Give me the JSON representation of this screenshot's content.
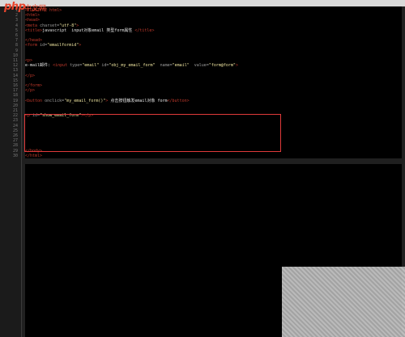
{
  "logo": {
    "brand": "php",
    "chinese": "中文网"
  },
  "editor": {
    "lines": [
      {
        "n": "1",
        "html": "<span class='tag'>&lt;!DOCTYPE html&gt;</span>"
      },
      {
        "n": "2",
        "html": "<span class='tag'>&lt;html&gt;</span>"
      },
      {
        "n": "3",
        "html": "<span class='tag'>&lt;head&gt;</span>"
      },
      {
        "n": "4",
        "html": "<span class='tag'>&lt;meta</span> <span class='attr'>charset=</span><span class='str'>\"utf-8\"</span><span class='tag'>&gt;</span>"
      },
      {
        "n": "5",
        "html": "<span class='tag'>&lt;title&gt;</span><span class='txt'>javascript  input对象email 类型form属性</span> <span class='tag'>&lt;/title&gt;</span>"
      },
      {
        "n": "6",
        "html": ""
      },
      {
        "n": "7",
        "html": "<span class='tag'>&lt;/head&gt;</span>"
      },
      {
        "n": "8",
        "html": "<span class='tag'>&lt;form</span> <span class='attr'>id=</span><span class='str'>\"emailformid\"</span><span class='tag'>&gt;</span>"
      },
      {
        "n": "9",
        "html": ""
      },
      {
        "n": "10",
        "html": ""
      },
      {
        "n": "11",
        "html": "<span class='tag'>&lt;p&gt;</span>"
      },
      {
        "n": "12",
        "html": "<span class='txt'>e-mail邮件: </span><span class='tag'>&lt;input</span> <span class='attr'>type=</span><span class='str'>\"email\"</span> <span class='attr'>id=</span><span class='str'>\"obj_my_email_form\"</span>  <span class='attr'>name=</span><span class='str'>\"email\"</span>  <span class='attr'>value=</span><span class='str'>\"form@form\"</span><span class='tag'>&gt;</span>"
      },
      {
        "n": "13",
        "html": ""
      },
      {
        "n": "14",
        "html": "<span class='tag'>&lt;/p&gt;</span>"
      },
      {
        "n": "15",
        "html": ""
      },
      {
        "n": "16",
        "html": "<span class='tag'>&lt;/form&gt;</span>"
      },
      {
        "n": "17",
        "html": "<span class='tag'>&lt;/p&gt;</span>"
      },
      {
        "n": "18",
        "html": ""
      },
      {
        "n": "19",
        "html": "<span class='tag'>&lt;button</span> <span class='attr'>onclick=</span><span class='str'>\"my_email_form()\"</span><span class='tag'>&gt;</span><span class='txt'> 点击按钮触发email对象 form</span><span class='tag'>&lt;/button&gt;</span>"
      },
      {
        "n": "20",
        "html": ""
      },
      {
        "n": "21",
        "html": ""
      },
      {
        "n": "22",
        "html": "<span class='tag'>&lt;p</span> <span class='attr'>id=</span><span class='str'>\"show_email_form\"</span><span class='tag'>&gt;&lt;/p&gt;</span>"
      },
      {
        "n": "23",
        "html": ""
      },
      {
        "n": "24",
        "html": ""
      },
      {
        "n": "25",
        "html": ""
      },
      {
        "n": "26",
        "html": ""
      },
      {
        "n": "27",
        "html": ""
      },
      {
        "n": "28",
        "html": ""
      },
      {
        "n": "29",
        "html": "<span class='tag'>&lt;/body&gt;</span>"
      },
      {
        "n": "30",
        "html": "<span class='tag'>&lt;/html&gt;</span>"
      }
    ]
  }
}
